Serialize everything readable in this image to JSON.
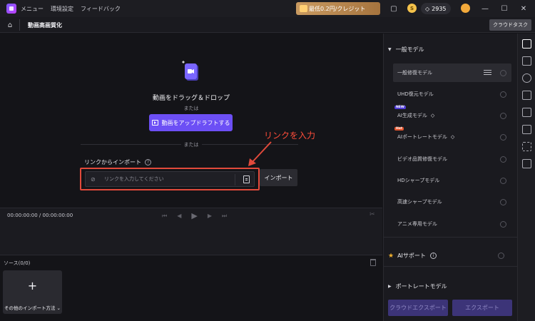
{
  "titlebar": {
    "menu": [
      "メニュー",
      "環境設定",
      "フィードバック"
    ],
    "promo": "最低0.2円/クレジット",
    "credits": "2935",
    "coin": "S",
    "icons": [
      "app-logo",
      "screen-icon",
      "coin-icon",
      "diamond-icon",
      "avatar",
      "minimize-icon",
      "maximize-icon",
      "close-icon"
    ]
  },
  "toolbar": {
    "title": "動画高画質化",
    "cloud_task": "クラウドタスク"
  },
  "upload": {
    "drag_text": "動画をドラッグ＆ドロップ",
    "or1": "または",
    "upload_button": "動画をアップドラフトする",
    "or2": "または",
    "link_label": "リンクからインポート",
    "help": "?",
    "link_placeholder": "リンクを入力してください",
    "import_button": "インポート",
    "annotation": "リンクを入力"
  },
  "playback": {
    "timecode": "00:00:00:00 / 00:00:00:00",
    "controls": [
      "skip-back-icon",
      "step-back-icon",
      "play-icon",
      "step-forward-icon",
      "skip-forward-icon"
    ]
  },
  "source": {
    "title": "ソース(0/0)",
    "plus": "+",
    "other_import": "その他のインポート方法 ⌄"
  },
  "right_panel": {
    "general_header": "一般モデル",
    "models": [
      {
        "label": "一般修復モデル",
        "selected": true
      },
      {
        "label": "UHD復元モデル"
      },
      {
        "label": "AI生成モデル",
        "tag": "NEW"
      },
      {
        "label": "AIポートレートモデル",
        "tag": "Hot"
      },
      {
        "label": "ビデオ品質修復モデル"
      },
      {
        "label": "HDシャープモデル"
      },
      {
        "label": "高速シャープモデル"
      },
      {
        "label": "アニメ専用モデル"
      }
    ],
    "ai_support": "AIサポート",
    "portrait_header": "ポートレートモデル",
    "cloud_export": "クラウドエクスポート",
    "export": "エクスポート"
  },
  "colors": {
    "accent": "#6c4ff5",
    "annotation_red": "#e24a3b",
    "background": "#141418"
  }
}
